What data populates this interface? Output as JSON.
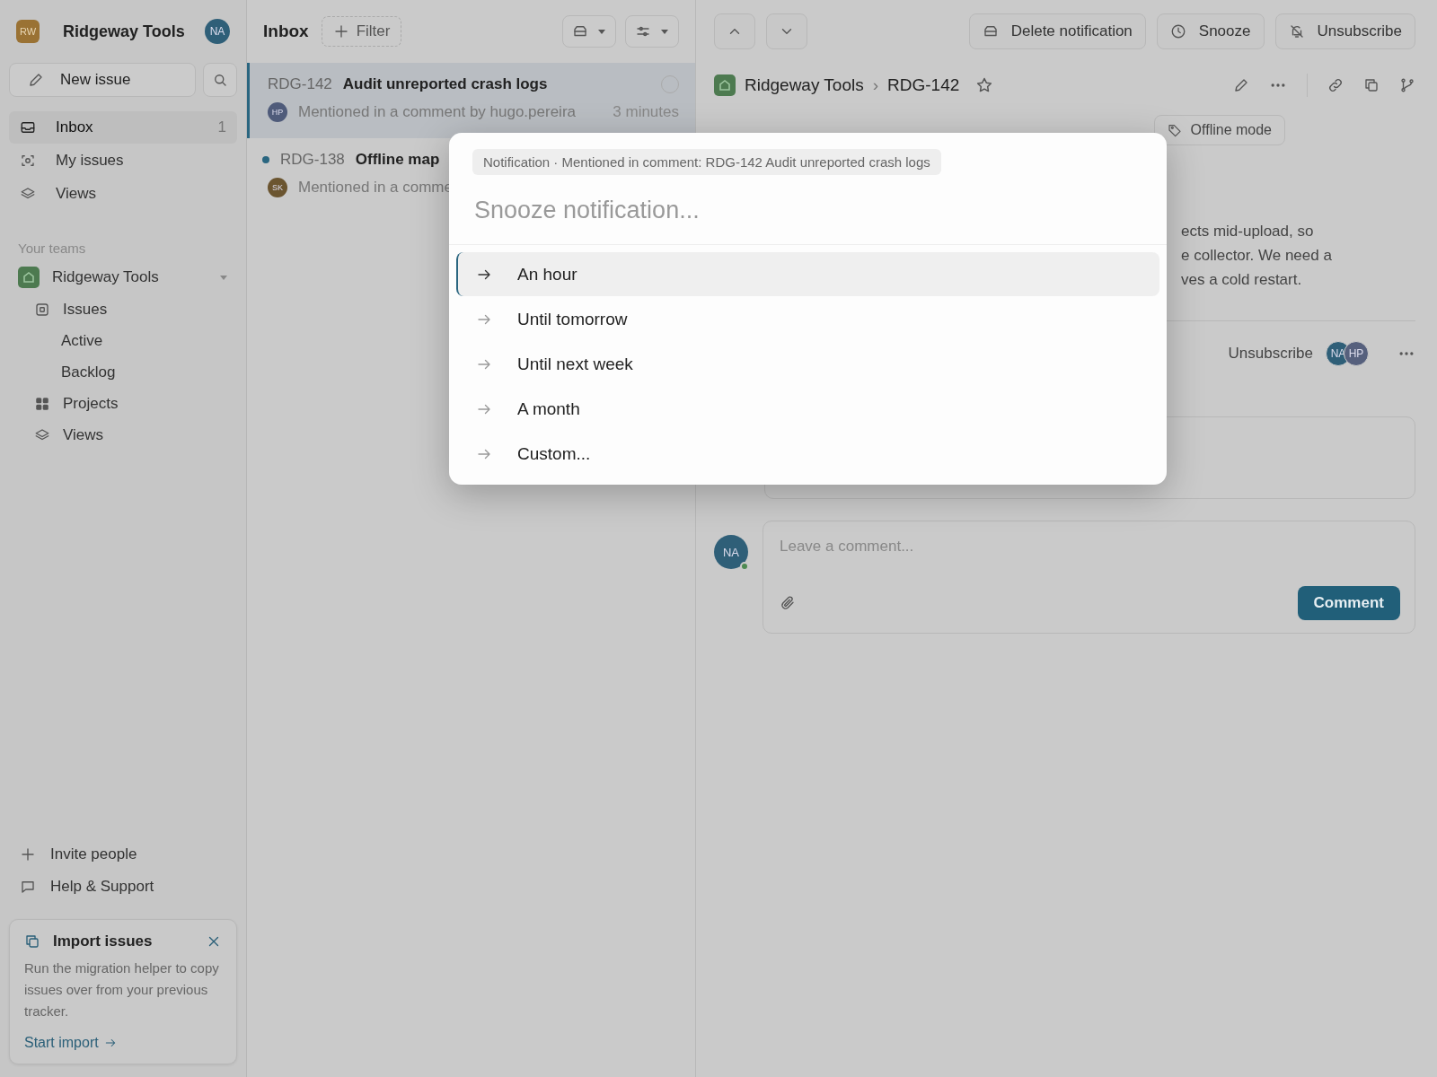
{
  "sidebar": {
    "workspace": {
      "initials": "RW",
      "name": "Ridgeway Tools"
    },
    "user_avatar": "NA",
    "new_issue": "New issue",
    "nav": [
      {
        "label": "Inbox",
        "count": "1",
        "selected": true
      },
      {
        "label": "My issues",
        "selected": false
      },
      {
        "label": "Views",
        "selected": false
      }
    ],
    "teams_heading": "Your teams",
    "team": {
      "name": "Ridgeway Tools",
      "items": [
        {
          "label": "Issues",
          "sub": false
        },
        {
          "label": "Active",
          "sub": true
        },
        {
          "label": "Backlog",
          "sub": true
        },
        {
          "label": "Projects",
          "sub": false
        },
        {
          "label": "Views",
          "sub": false
        }
      ]
    },
    "footer": [
      "Invite people",
      "Help & Support"
    ],
    "import_card": {
      "title": "Import issues",
      "body": "Run the migration helper to copy issues over from your previous tracker.",
      "link": "Start import"
    }
  },
  "inbox": {
    "title": "Inbox",
    "filter": "Filter",
    "items": [
      {
        "id": "RDG-142",
        "title": "Audit unreported crash logs",
        "avatar": "HP",
        "color": "#4f5b7a",
        "message": "Mentioned in a comment by hugo.pereira",
        "time": "3 minutes",
        "selected": true,
        "unread": false
      },
      {
        "id": "RDG-138",
        "title": "Offline map",
        "avatar": "SK",
        "color": "#6b5530",
        "message": "Mentioned in a comme",
        "selected": false,
        "unread": true
      }
    ]
  },
  "detail": {
    "actions": [
      "Delete notification",
      "Snooze",
      "Unsubscribe"
    ],
    "breadcrumb": {
      "team": "Ridgeway Tools",
      "separator": "›",
      "issue": "RDG-142"
    },
    "chip": "Offline mode",
    "description": [
      "ects mid-upload, so",
      "e collector. We need a",
      "ves a cold restart."
    ],
    "subscribe": "Unsubscribe",
    "subscribers": [
      {
        "initials": "NA",
        "color": "#2f5f78"
      },
      {
        "initials": "HP",
        "color": "#56607d"
      }
    ],
    "comment": {
      "avatar": "NA",
      "placeholder": "Leave a comment...",
      "button": "Comment"
    }
  },
  "snooze_dialog": {
    "context": "Notification · Mentioned in comment: RDG-142 Audit unreported crash logs",
    "placeholder": "Snooze notification...",
    "options": [
      {
        "label": "An hour",
        "selected": true
      },
      {
        "label": "Until tomorrow",
        "selected": false
      },
      {
        "label": "Until next week",
        "selected": false
      },
      {
        "label": "A month",
        "selected": false
      },
      {
        "label": "Custom...",
        "selected": false
      }
    ]
  }
}
